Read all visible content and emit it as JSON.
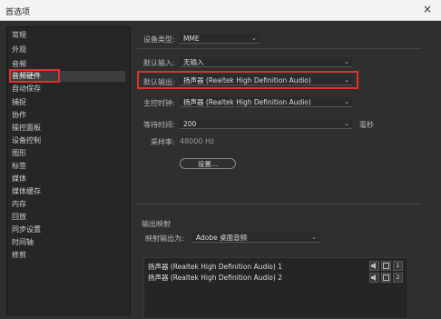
{
  "window": {
    "title": "首选项",
    "close_icon": "×"
  },
  "sidebar": {
    "items": [
      {
        "label": "常规"
      },
      {
        "label": "外观"
      },
      {
        "label": "音频"
      },
      {
        "label": "音频硬件"
      },
      {
        "label": "自动保存"
      },
      {
        "label": "捕捉"
      },
      {
        "label": "协作"
      },
      {
        "label": "操控面板"
      },
      {
        "label": "设备控制"
      },
      {
        "label": "图形"
      },
      {
        "label": "标签"
      },
      {
        "label": "媒体"
      },
      {
        "label": "媒体缓存"
      },
      {
        "label": "内存"
      },
      {
        "label": "回放"
      },
      {
        "label": "同步设置"
      },
      {
        "label": "时间轴"
      },
      {
        "label": "修剪"
      }
    ],
    "selected_index": 3
  },
  "audio_hw": {
    "device_type_label": "设备类型:",
    "device_type_value": "MME",
    "default_input_label": "默认输入:",
    "default_input_value": "无输入",
    "default_output_label": "默认输出:",
    "default_output_value": "扬声器 (Realtek High Definition Audio)",
    "master_clock_label": "主控时钟:",
    "master_clock_value": "扬声器 (Realtek High Definition Audio)",
    "latency_label": "等待时间:",
    "latency_value": "200",
    "latency_unit": "毫秒",
    "sample_rate_label": "采样率:",
    "sample_rate_value": "48000 Hz",
    "settings_button": "设置..."
  },
  "output_mapping": {
    "section_title": "输出映射",
    "map_to_label": "映射输出为:",
    "map_to_value": "Adobe 桌面音频",
    "channels": [
      {
        "label": "扬声器 (Realtek High Definition Audio) 1",
        "number": "1"
      },
      {
        "label": "扬声器 (Realtek High Definition Audio) 2",
        "number": "2"
      }
    ]
  },
  "chevron": "⌄"
}
